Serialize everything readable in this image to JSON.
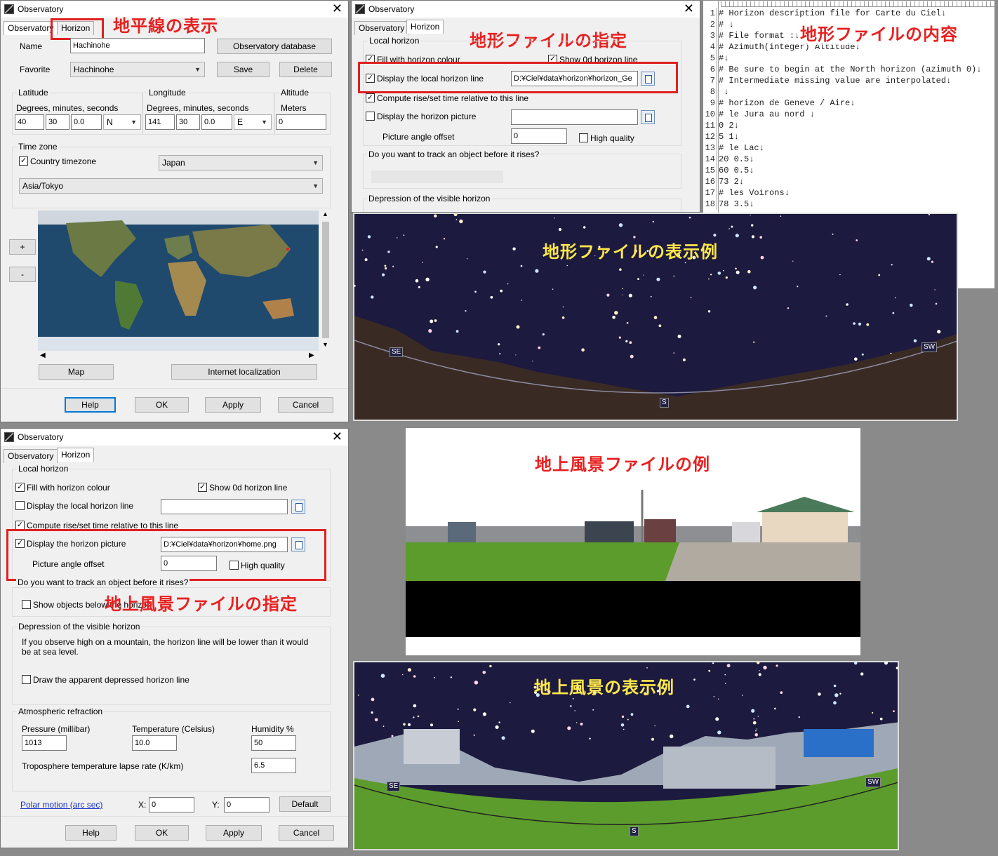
{
  "win1": {
    "title": "Observatory",
    "tabs": [
      "Observatory",
      "Horizon"
    ],
    "name_label": "Name",
    "name_value": "Hachinohe",
    "obs_db_button": "Observatory database",
    "favorite_label": "Favorite",
    "favorite_value": "Hachinohe",
    "save_button": "Save",
    "delete_button": "Delete",
    "latitude_label": "Latitude",
    "lat_dms_label": "Degrees, minutes, seconds",
    "lat_values": [
      "40",
      "30",
      "0.0",
      "N"
    ],
    "longitude_label": "Longitude",
    "lon_dms_label": "Degrees, minutes, seconds",
    "lon_values": [
      "141",
      "30",
      "0.0",
      "E"
    ],
    "altitude_label": "Altitude",
    "meters_label": "Meters",
    "altitude_value": "0",
    "timezone_label": "Time zone",
    "country_tz_label": "Country timezone",
    "country_value": "Japan",
    "tz_value": "Asia/Tokyo",
    "zoom_in": "+",
    "zoom_out": "-",
    "map_button": "Map",
    "inet_button": "Internet localization",
    "help": "Help",
    "ok": "OK",
    "apply": "Apply",
    "cancel": "Cancel",
    "annotation": "地平線の表示"
  },
  "win2": {
    "title": "Observatory",
    "tabs": [
      "Observatory",
      "Horizon"
    ],
    "local_horizon": "Local horizon",
    "fill_colour": "Fill with horizon colour",
    "show_0d": "Show 0d horizon line",
    "display_local": "Display the local horizon line",
    "local_path": "D:¥Ciel¥data¥horizon¥horizon_Ge",
    "compute_rise": "Compute rise/set time relative to this line",
    "display_picture": "Display the horizon picture",
    "picture_offset": "Picture angle offset",
    "offset_value": "0",
    "high_quality": "High quality",
    "track_question": "Do you want to track an object before it rises?",
    "depression": "Depression of the visible horizon",
    "annotation": "地形ファイルの指定"
  },
  "editor": {
    "annotation": "地形ファイルの内容",
    "lines": [
      "# Horizon description file for Carte du Ciel↓",
      "# ↓",
      "# File format :↓",
      "# Azimuth(integer) Altitude↓",
      "#↓",
      "# Be sure to begin at the North horizon (azimuth 0)↓",
      "# Intermediate missing value are interpolated↓",
      " ↓",
      "# horizon de Geneve / Aire↓",
      "# le Jura au nord ↓",
      "0 2↓",
      "5 1↓",
      "# le Lac↓",
      "20 0.5↓",
      "60 0.5↓",
      "73 2↓",
      "# les Voirons↓",
      "78 3.5↓"
    ]
  },
  "sky1": {
    "annotation": "地形ファイルの表示例",
    "se": "SE",
    "s": "S",
    "sw": "SW"
  },
  "win3": {
    "title": "Observatory",
    "tabs": [
      "Observatory",
      "Horizon"
    ],
    "local_horizon": "Local horizon",
    "fill_colour": "Fill with horizon colour",
    "show_0d": "Show 0d horizon line",
    "display_local": "Display the local horizon line",
    "compute_rise": "Compute rise/set time relative to this line",
    "display_picture": "Display the horizon picture",
    "picture_path": "D:¥Ciel¥data¥horizon¥home.png",
    "picture_offset": "Picture angle offset",
    "offset_value": "0",
    "high_quality": "High quality",
    "track_question": "Do you want to track an object before it rises?",
    "show_below": "Show objects below the horizon",
    "depression": "Depression of the visible horizon",
    "depression_text": "If you observe high on a mountain, the horizon line will be lower than it would be at sea level.",
    "draw_depressed": "Draw the apparent depressed horizon line",
    "refraction": "Atmospheric refraction",
    "pressure_label": "Pressure (millibar)",
    "pressure_value": "1013",
    "temperature_label": "Temperature (Celsius)",
    "temperature_value": "10.0",
    "humidity_label": "Humidity %",
    "humidity_value": "50",
    "lapse_label": "Troposphere temperature lapse rate (K/km)",
    "lapse_value": "6.5",
    "polar_motion": "Polar motion (arc sec)",
    "x_label": "X:",
    "x_value": "0",
    "y_label": "Y:",
    "y_value": "0",
    "default_button": "Default",
    "help": "Help",
    "ok": "OK",
    "apply": "Apply",
    "cancel": "Cancel",
    "annotation": "地上風景ファイルの指定"
  },
  "landscape": {
    "annotation": "地上風景ファイルの例"
  },
  "sky2": {
    "annotation": "地上風景の表示例",
    "se": "SE",
    "s": "S",
    "sw": "SW"
  },
  "colors": {
    "annotation_red": "#e82020",
    "annotation_yellow": "#ffe84a",
    "sky": "#1c1a3e",
    "ground": "#3a2a24",
    "grass": "#5c9c2c"
  }
}
